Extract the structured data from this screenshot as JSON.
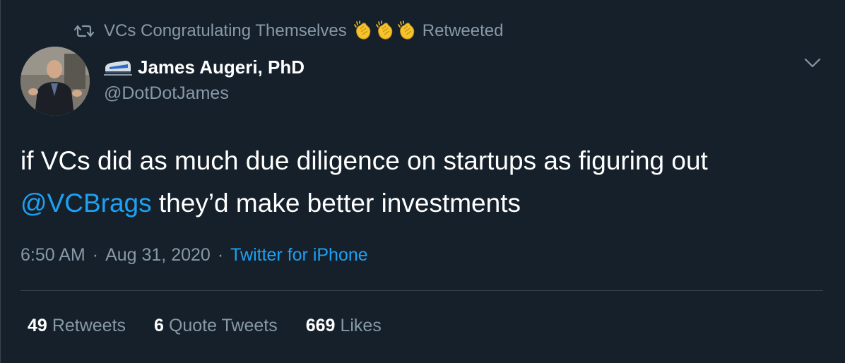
{
  "retweet_context": {
    "retweeter_name": "VCs Congratulating Themselves",
    "emoji": [
      "clapping-hands",
      "clapping-hands",
      "clapping-hands"
    ],
    "label": "Retweeted"
  },
  "author": {
    "display_name": "James Augeri, PhD",
    "handle": "@DotDotJames",
    "name_emoji": "high-speed-train"
  },
  "tweet": {
    "text_before": "if VCs did as much due diligence on startups as figuring out ",
    "mention": "@VCBrags",
    "text_after": " they’d make better investments"
  },
  "meta": {
    "time": "6:50 AM",
    "separator": "·",
    "date": "Aug 31, 2020",
    "source": "Twitter for iPhone"
  },
  "stats": {
    "retweets_count": "49",
    "retweets_label": "Retweets",
    "quotes_count": "6",
    "quotes_label": "Quote Tweets",
    "likes_count": "669",
    "likes_label": "Likes"
  },
  "colors": {
    "background": "#15202b",
    "link": "#1da1f2",
    "secondary_text": "#8899a6",
    "divider": "#38444d"
  }
}
